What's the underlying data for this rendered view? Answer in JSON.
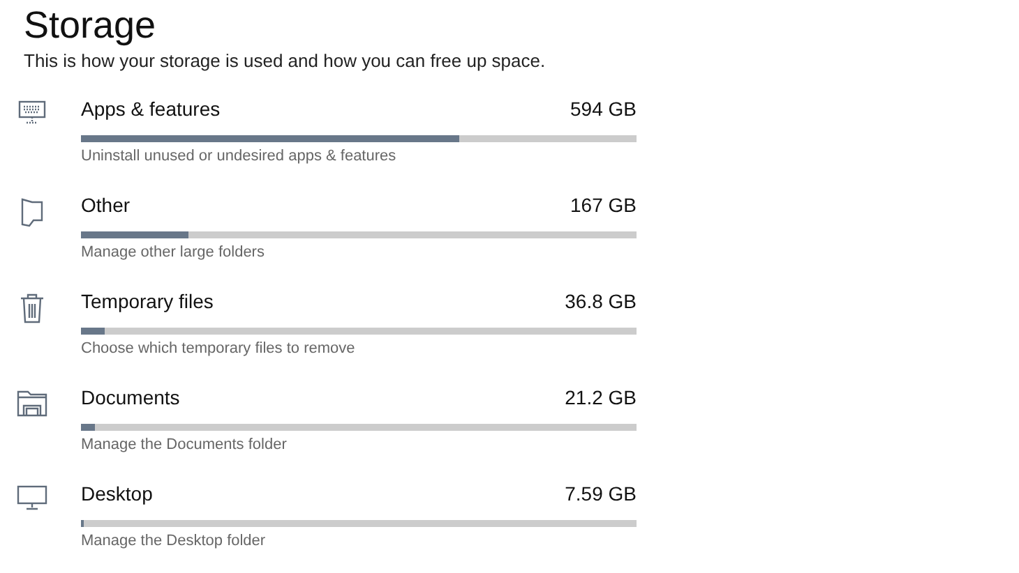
{
  "title": "Storage",
  "subtitle": "This is how your storage is used and how you can free up space.",
  "categories": [
    {
      "kind": "apps",
      "name": "Apps & features",
      "size": "594 GB",
      "level": 0.68,
      "description": "Uninstall unused or undesired apps & features"
    },
    {
      "kind": "other",
      "name": "Other",
      "size": "167 GB",
      "level": 0.194,
      "description": "Manage other large folders"
    },
    {
      "kind": "temp",
      "name": "Temporary files",
      "size": "36.8 GB",
      "level": 0.043,
      "description": "Choose which temporary files to remove"
    },
    {
      "kind": "documents",
      "name": "Documents",
      "size": "21.2 GB",
      "level": 0.025,
      "description": "Manage the Documents folder"
    },
    {
      "kind": "desktop",
      "name": "Desktop",
      "size": "7.59 GB",
      "level": 0.005,
      "description": "Manage the Desktop folder"
    }
  ]
}
